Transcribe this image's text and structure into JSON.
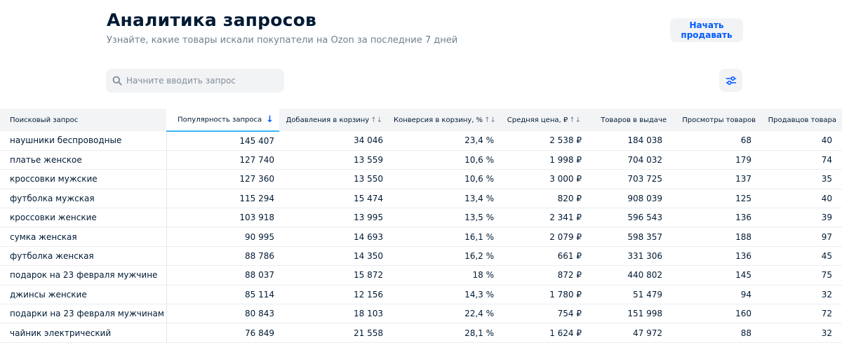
{
  "header": {
    "title": "Аналитика запросов",
    "subtitle": "Узнайте, какие товары искали покупатели на Ozon за последние 7 дней",
    "sell_button": "Начать продавать"
  },
  "search": {
    "placeholder": "Начните вводить запрос"
  },
  "colors": {
    "accent": "#005bff",
    "sorted_underline": "#3bb6f5",
    "header_bg": "#f3f4f6",
    "text": "#001a34",
    "muted": "#707f8d"
  },
  "table": {
    "columns": [
      {
        "label": "Поисковый запрос",
        "sort": ""
      },
      {
        "label": "Популярность запроса",
        "sort": "↓"
      },
      {
        "label": "Добавления в корзину",
        "sort": "↑↓"
      },
      {
        "label": "Конверсия в корзину, %",
        "sort": "↑↓"
      },
      {
        "label": "Средняя цена, ₽",
        "sort": "↑↓"
      },
      {
        "label": "Товаров в выдаче",
        "sort": ""
      },
      {
        "label": "Просмотры товаров",
        "sort": ""
      },
      {
        "label": "Продавцов товара",
        "sort": ""
      }
    ],
    "rows": [
      [
        "наушники беспроводные",
        "145 407",
        "34 046",
        "23,4 %",
        "2 538 ₽",
        "184 038",
        "68",
        "40"
      ],
      [
        "платье женское",
        "127 740",
        "13 559",
        "10,6 %",
        "1 998 ₽",
        "704 032",
        "179",
        "74"
      ],
      [
        "кроссовки мужские",
        "127 360",
        "13 550",
        "10,6 %",
        "3 000 ₽",
        "703 725",
        "137",
        "35"
      ],
      [
        "футболка мужская",
        "115 294",
        "15 474",
        "13,4 %",
        "820 ₽",
        "908 039",
        "125",
        "40"
      ],
      [
        "кроссовки женские",
        "103 918",
        "13 995",
        "13,5 %",
        "2 341 ₽",
        "596 543",
        "136",
        "39"
      ],
      [
        "сумка женская",
        "90 995",
        "14 693",
        "16,1 %",
        "2 079 ₽",
        "598 357",
        "188",
        "97"
      ],
      [
        "футболка женская",
        "88 786",
        "14 350",
        "16,2 %",
        "661 ₽",
        "331 306",
        "136",
        "45"
      ],
      [
        "подарок на 23 февраля мужчине",
        "88 037",
        "15 872",
        "18 %",
        "872 ₽",
        "440 802",
        "145",
        "75"
      ],
      [
        "джинсы женские",
        "85 114",
        "12 156",
        "14,3 %",
        "1 780 ₽",
        "51 479",
        "94",
        "32"
      ],
      [
        "подарки на 23 февраля мужчинам",
        "80 843",
        "18 103",
        "22,4 %",
        "754 ₽",
        "151 998",
        "160",
        "72"
      ],
      [
        "чайник электрический",
        "76 849",
        "21 558",
        "28,1 %",
        "1 624 ₽",
        "47 972",
        "88",
        "32"
      ]
    ]
  }
}
